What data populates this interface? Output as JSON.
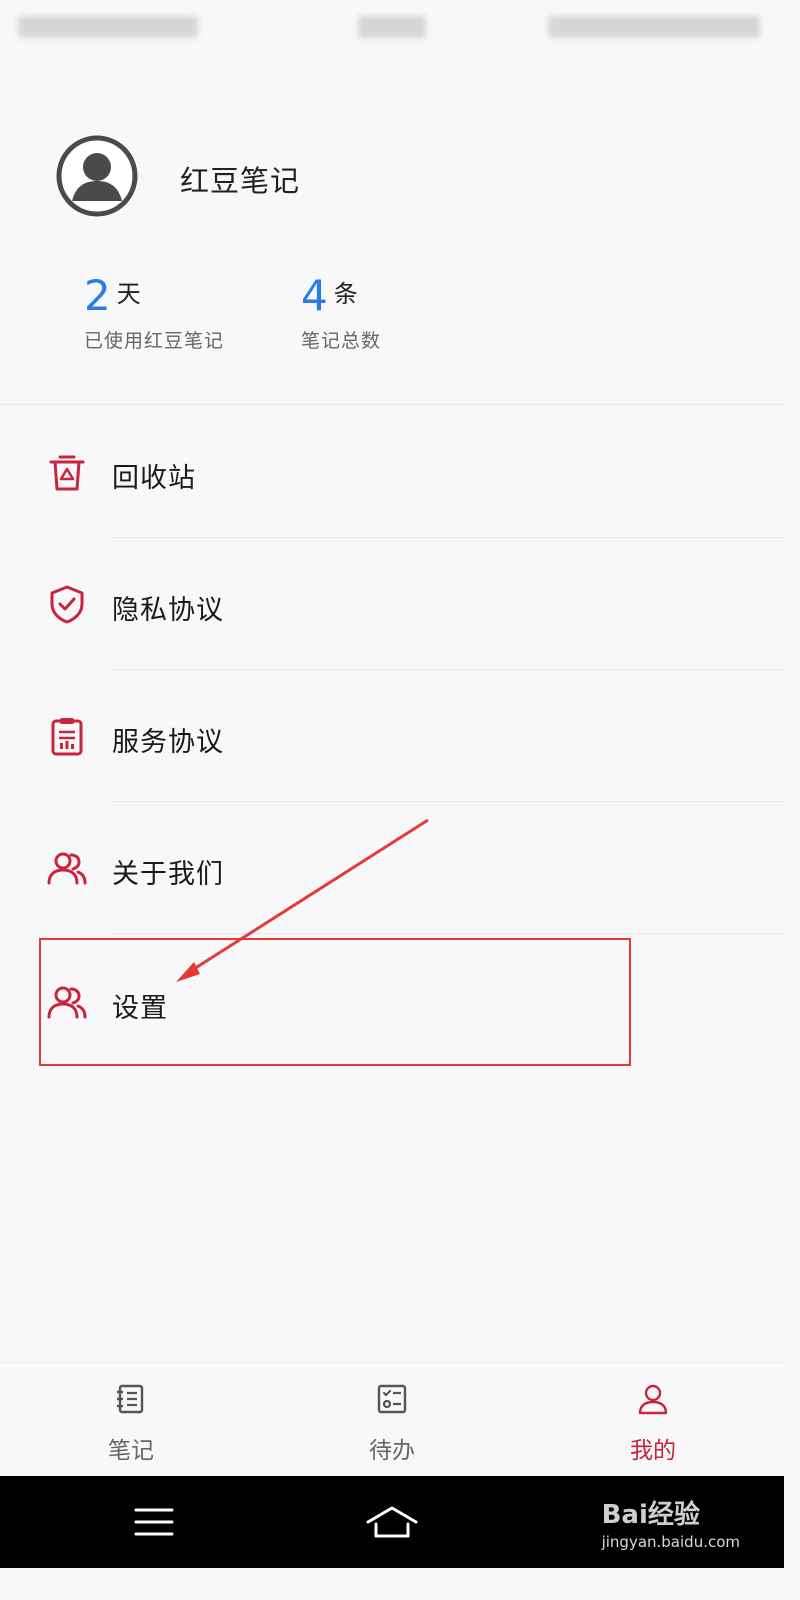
{
  "profile": {
    "app_name": "红豆笔记"
  },
  "stats": [
    {
      "value": "2",
      "unit": "天",
      "label": "已使用红豆笔记"
    },
    {
      "value": "4",
      "unit": "条",
      "label": "笔记总数"
    }
  ],
  "menu": [
    {
      "label": "回收站",
      "icon": "recycle-bin-icon"
    },
    {
      "label": "隐私协议",
      "icon": "shield-check-icon"
    },
    {
      "label": "服务协议",
      "icon": "clipboard-document-icon"
    },
    {
      "label": "关于我们",
      "icon": "users-icon"
    },
    {
      "label": "设置",
      "icon": "users-icon"
    }
  ],
  "tabs": [
    {
      "label": "笔记",
      "icon": "notebook-icon",
      "active": false
    },
    {
      "label": "待办",
      "icon": "checklist-icon",
      "active": false
    },
    {
      "label": "我的",
      "icon": "person-icon",
      "active": true
    }
  ],
  "colors": {
    "accent_red": "#c8243b",
    "stat_blue": "#2a7ce8",
    "annotation_red": "#e53935"
  },
  "watermark": {
    "brand": "Bai经验",
    "url": "jingyan.baidu.com"
  }
}
